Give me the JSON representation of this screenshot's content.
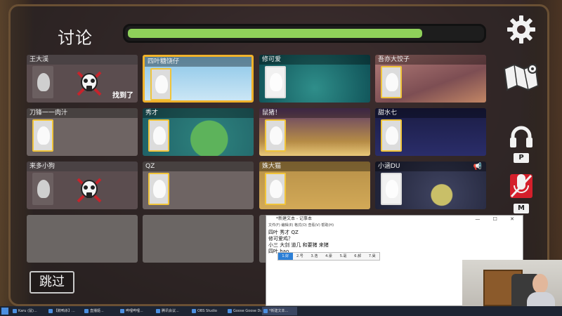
{
  "header": {
    "title": "讨论",
    "timer_progress": 0.82
  },
  "players": [
    {
      "name": "王大渓",
      "status": "dead",
      "found_label": "找到了",
      "bg": "dim"
    },
    {
      "name": "四叶糖饶仔",
      "status": "alive",
      "selected": true,
      "bg": "bg-sky",
      "avatar": "blue"
    },
    {
      "name": "修可爱",
      "status": "alive",
      "bg": "bg-water",
      "avatar": "white"
    },
    {
      "name": "吾亦大饺子",
      "status": "alive",
      "bg": "bg-sand",
      "avatar": "pink"
    },
    {
      "name": "刀锋一一肉汁",
      "status": "alive",
      "bg": "plain",
      "avatar": "chef"
    },
    {
      "name": "秀才",
      "status": "alive",
      "bg": "bg-pad",
      "avatar": "green"
    },
    {
      "name": "鼠猪！",
      "status": "alive",
      "bg": "bg-rabbit",
      "avatar": "dark"
    },
    {
      "name": "甜水七",
      "status": "alive",
      "bg": "bg-night",
      "avatar": "green"
    },
    {
      "name": "来多小狗",
      "status": "dead",
      "found_label": "",
      "bg": "dim"
    },
    {
      "name": "QZ",
      "status": "alive",
      "bg": "plain",
      "avatar": "purple"
    },
    {
      "name": "姝大猫",
      "status": "alive",
      "bg": "bg-cheese",
      "avatar": "old"
    },
    {
      "name": "小涵DU",
      "status": "alive",
      "bg": "bg-moon",
      "avatar": "white",
      "speaking": true
    },
    {
      "name": "",
      "status": "empty"
    },
    {
      "name": "",
      "status": "empty"
    },
    {
      "name": "",
      "status": "empty"
    }
  ],
  "controls": {
    "settings_icon": "gear-icon",
    "map_icon": "map-icon",
    "push_to_talk_key": "P",
    "mute_key": "M"
  },
  "skip_label": "跳过",
  "notepad": {
    "title": "*新建文本 - 记事本",
    "menu": "文件(F)  编辑(E)  格式(O)  查看(V)  帮助(H)",
    "lines": [
      "四叶 秀才 QZ",
      "修可爱鸡？",
      "小三 大剑 道几 和要猪 来猪",
      "四叶 hao"
    ],
    "ime_candidates": [
      "1.好",
      "2.号",
      "3.浩",
      "4.豪",
      "5.毫",
      "6.郝",
      "7.昊"
    ]
  },
  "taskbar": {
    "items": [
      "Karu (鼠)...",
      "【鹅鸭杀】...",
      "直播姬...",
      "哔哩哔哩...",
      "腾讯会议...",
      "OBS Studio",
      "Goose Goose Duck",
      "*新建文本..."
    ]
  },
  "colors": {
    "timer": "#8fd15a",
    "selected": "#f0b22b",
    "ime_active": "#2c7fd6"
  }
}
